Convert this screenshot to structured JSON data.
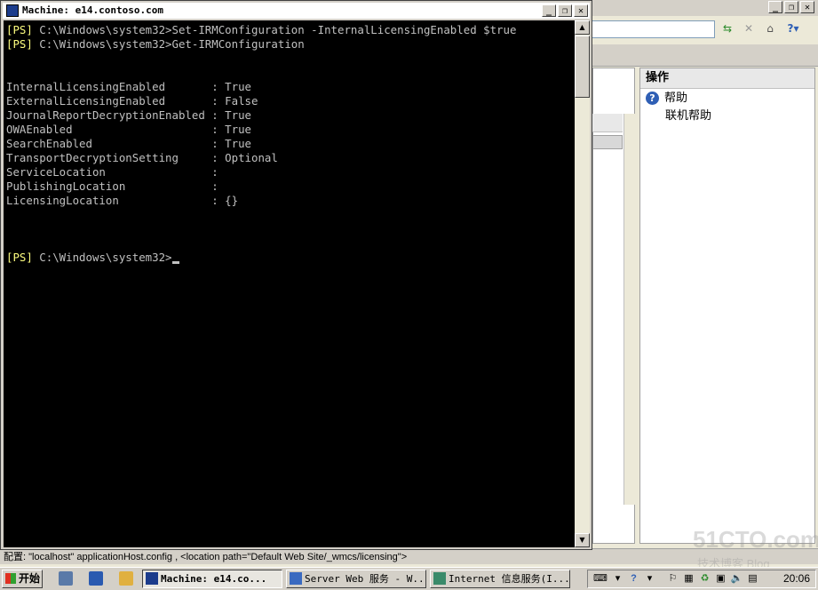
{
  "console": {
    "title": "Machine: e14.contoso.com",
    "lines": [
      {
        "prompt": "[PS]",
        "text": " C:\\Windows\\system32>Set-IRMConfiguration -InternalLicensingEnabled $true"
      },
      {
        "prompt": "[PS]",
        "text": " C:\\Windows\\system32>Get-IRMConfiguration"
      },
      {
        "prompt": "",
        "text": ""
      },
      {
        "prompt": "",
        "text": ""
      },
      {
        "prompt": "",
        "text": "InternalLicensingEnabled       : True"
      },
      {
        "prompt": "",
        "text": "ExternalLicensingEnabled       : False"
      },
      {
        "prompt": "",
        "text": "JournalReportDecryptionEnabled : True"
      },
      {
        "prompt": "",
        "text": "OWAEnabled                     : True"
      },
      {
        "prompt": "",
        "text": "SearchEnabled                  : True"
      },
      {
        "prompt": "",
        "text": "TransportDecryptionSetting     : Optional"
      },
      {
        "prompt": "",
        "text": "ServiceLocation                :"
      },
      {
        "prompt": "",
        "text": "PublishingLocation             :"
      },
      {
        "prompt": "",
        "text": "LicensingLocation              : {}"
      },
      {
        "prompt": "",
        "text": ""
      },
      {
        "prompt": "",
        "text": ""
      },
      {
        "prompt": "",
        "text": ""
      },
      {
        "prompt": "[PS]",
        "text": " C:\\Windows\\system32>"
      }
    ]
  },
  "actions_pane": {
    "header": "操作",
    "help": "帮助",
    "online_help": "联机帮助"
  },
  "statusbar": {
    "text": "配置: \"localhost\" applicationHost.config , <location path=\"Default Web Site/_wmcs/licensing\">"
  },
  "taskbar": {
    "start": "开始",
    "tasks": [
      {
        "label": "Machine: e14.co...",
        "active": true
      },
      {
        "label": "Server Web 服务 - W...",
        "active": false
      },
      {
        "label": "Internet 信息服务(I...",
        "active": false
      }
    ],
    "clock": "20:06"
  },
  "watermark": {
    "main": "51CTO.com",
    "sub": "技术博客  Blog"
  },
  "colors": {
    "console_bg": "#000000",
    "console_fg": "#c0c0c0",
    "prompt": "#ffff80"
  }
}
